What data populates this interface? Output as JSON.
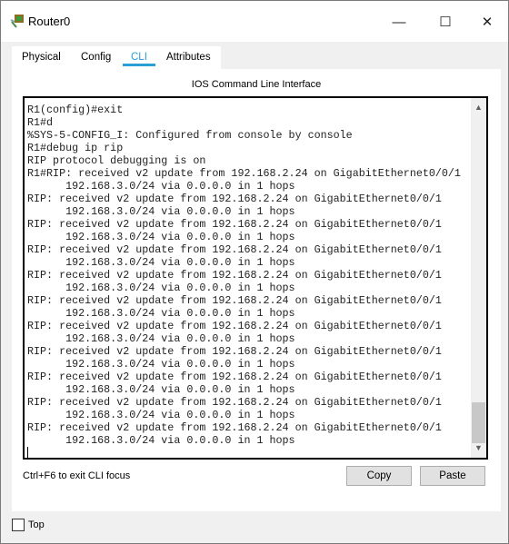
{
  "window": {
    "title": "Router0",
    "minimize": "—",
    "maximize": "☐",
    "close": "✕"
  },
  "tabs": [
    {
      "label": "Physical"
    },
    {
      "label": "Config"
    },
    {
      "label": "CLI",
      "active": true
    },
    {
      "label": "Attributes"
    }
  ],
  "cli": {
    "heading": "IOS Command Line Interface",
    "lines": [
      "R1(config)#exit",
      "R1#d",
      "%SYS-5-CONFIG_I: Configured from console by console",
      "R1#debug ip rip",
      "RIP protocol debugging is on",
      "R1#RIP: received v2 update from 192.168.2.24 on GigabitEthernet0/0/1",
      "      192.168.3.0/24 via 0.0.0.0 in 1 hops",
      "RIP: received v2 update from 192.168.2.24 on GigabitEthernet0/0/1",
      "      192.168.3.0/24 via 0.0.0.0 in 1 hops",
      "RIP: received v2 update from 192.168.2.24 on GigabitEthernet0/0/1",
      "      192.168.3.0/24 via 0.0.0.0 in 1 hops",
      "RIP: received v2 update from 192.168.2.24 on GigabitEthernet0/0/1",
      "      192.168.3.0/24 via 0.0.0.0 in 1 hops",
      "RIP: received v2 update from 192.168.2.24 on GigabitEthernet0/0/1",
      "      192.168.3.0/24 via 0.0.0.0 in 1 hops",
      "RIP: received v2 update from 192.168.2.24 on GigabitEthernet0/0/1",
      "      192.168.3.0/24 via 0.0.0.0 in 1 hops",
      "RIP: received v2 update from 192.168.2.24 on GigabitEthernet0/0/1",
      "      192.168.3.0/24 via 0.0.0.0 in 1 hops",
      "RIP: received v2 update from 192.168.2.24 on GigabitEthernet0/0/1",
      "      192.168.3.0/24 via 0.0.0.0 in 1 hops",
      "RIP: received v2 update from 192.168.2.24 on GigabitEthernet0/0/1",
      "      192.168.3.0/24 via 0.0.0.0 in 1 hops",
      "RIP: received v2 update from 192.168.2.24 on GigabitEthernet0/0/1",
      "      192.168.3.0/24 via 0.0.0.0 in 1 hops",
      "RIP: received v2 update from 192.168.2.24 on GigabitEthernet0/0/1",
      "      192.168.3.0/24 via 0.0.0.0 in 1 hops"
    ],
    "hint": "Ctrl+F6 to exit CLI focus",
    "copy_label": "Copy",
    "paste_label": "Paste"
  },
  "footer": {
    "top_label": "Top",
    "top_checked": false
  },
  "colors": {
    "accent": "#2a9fd6"
  }
}
